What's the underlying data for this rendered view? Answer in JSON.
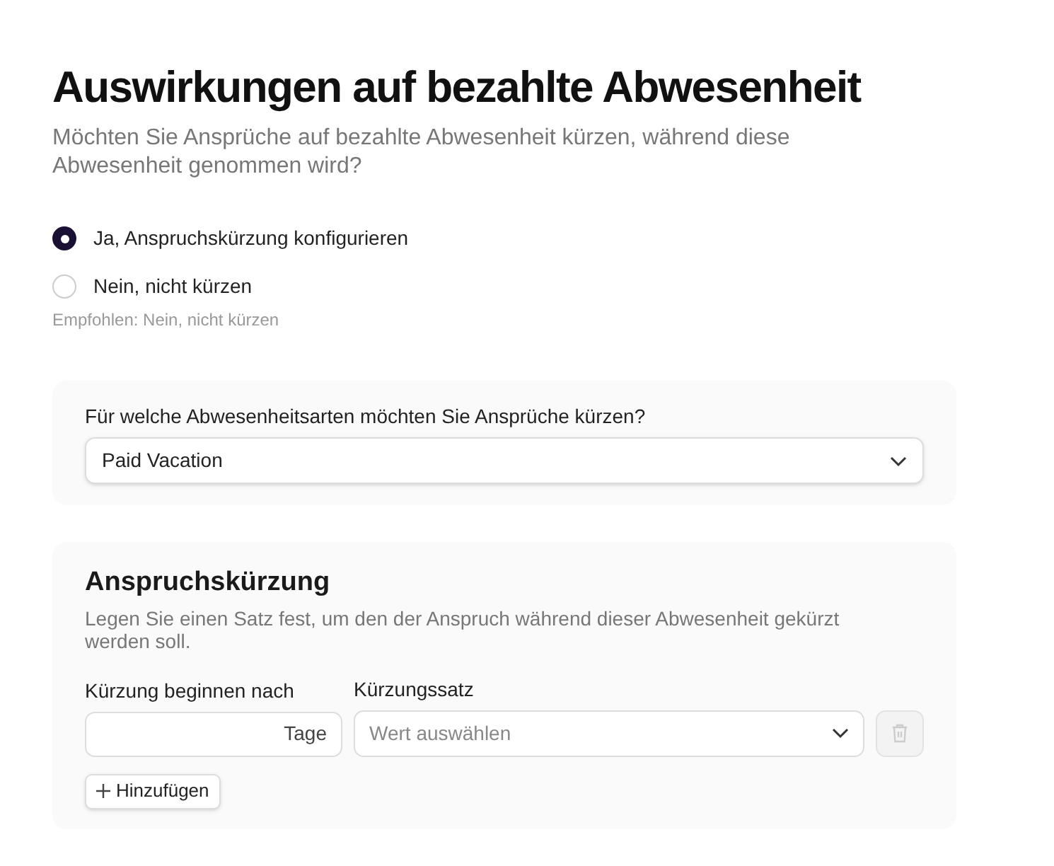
{
  "title": "Auswirkungen auf bezahlte Abwesenheit",
  "subtitle": "Möchten Sie Ansprüche auf bezahlte Abwesenheit kürzen, während diese Abwesenheit genommen wird?",
  "options": [
    {
      "label": "Ja, Anspruchskürzung konfigurieren",
      "selected": true
    },
    {
      "label": "Nein, nicht kürzen",
      "selected": false
    }
  ],
  "recommendation": "Empfohlen: Nein, nicht kürzen",
  "absence_types": {
    "label": "Für welche Abwesenheitsarten möchten Sie Ansprüche kürzen?",
    "value": "Paid Vacation"
  },
  "reduction": {
    "heading": "Anspruchskürzung",
    "description": "Legen Sie einen Satz fest, um den der Anspruch während dieser Abwesenheit gekürzt werden soll.",
    "start_label": "Kürzung beginnen nach",
    "start_unit": "Tage",
    "rate_label": "Kürzungssatz",
    "rate_placeholder": "Wert auswählen",
    "delete_disabled": true,
    "add_button": "Hinzufügen"
  }
}
